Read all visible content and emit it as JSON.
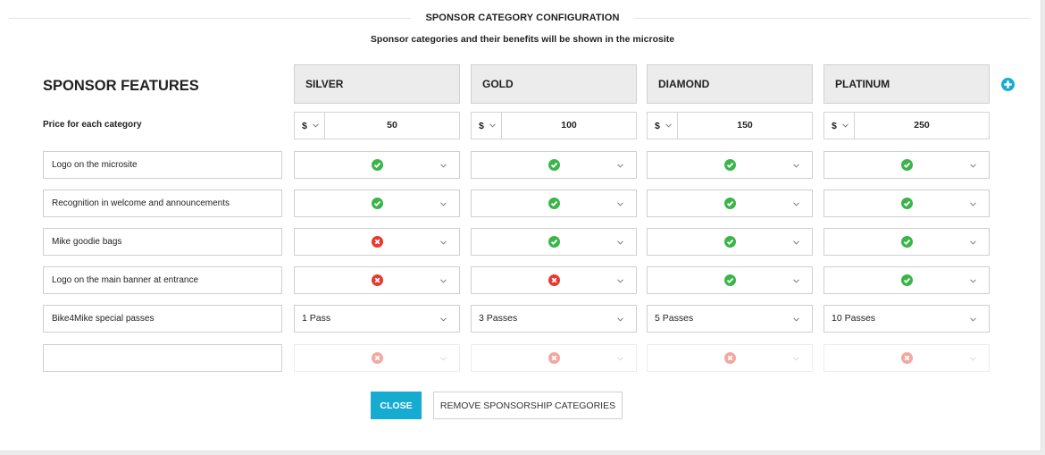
{
  "header": {
    "title": "SPONSOR CATEGORY CONFIGURATION",
    "subtitle": "Sponsor categories and their benefits will be shown in the microsite"
  },
  "features_title": "SPONSOR FEATURES",
  "price_label": "Price for each category",
  "add_category_icon": "plus-circle-icon",
  "colors": {
    "accent": "#16acd1",
    "check": "#3bb54a",
    "cross": "#e8392d",
    "cross_faded": "#f2a8a2",
    "header_bg": "#ececec"
  },
  "categories": [
    {
      "name": "SILVER",
      "currency": "$",
      "price": "50"
    },
    {
      "name": "GOLD",
      "currency": "$",
      "price": "100"
    },
    {
      "name": "DIAMOND",
      "currency": "$",
      "price": "150"
    },
    {
      "name": "PLATINUM",
      "currency": "$",
      "price": "250"
    }
  ],
  "features": [
    {
      "label": "Logo on the microsite",
      "values": [
        "check",
        "check",
        "check",
        "check"
      ]
    },
    {
      "label": "Recognition in welcome and announcements",
      "values": [
        "check",
        "check",
        "check",
        "check"
      ]
    },
    {
      "label": "Mike goodie bags",
      "values": [
        "cross",
        "check",
        "check",
        "check"
      ]
    },
    {
      "label": "Logo on the main banner at entrance",
      "values": [
        "cross",
        "cross",
        "check",
        "check"
      ]
    },
    {
      "label": "Bike4Mike special passes",
      "values": [
        "1 Pass",
        "3 Passes",
        "5 Passes",
        "10 Passes"
      ]
    },
    {
      "label": "",
      "values": [
        "cross-faded",
        "cross-faded",
        "cross-faded",
        "cross-faded"
      ]
    }
  ],
  "buttons": {
    "close": "CLOSE",
    "remove": "REMOVE SPONSORSHIP CATEGORIES"
  }
}
